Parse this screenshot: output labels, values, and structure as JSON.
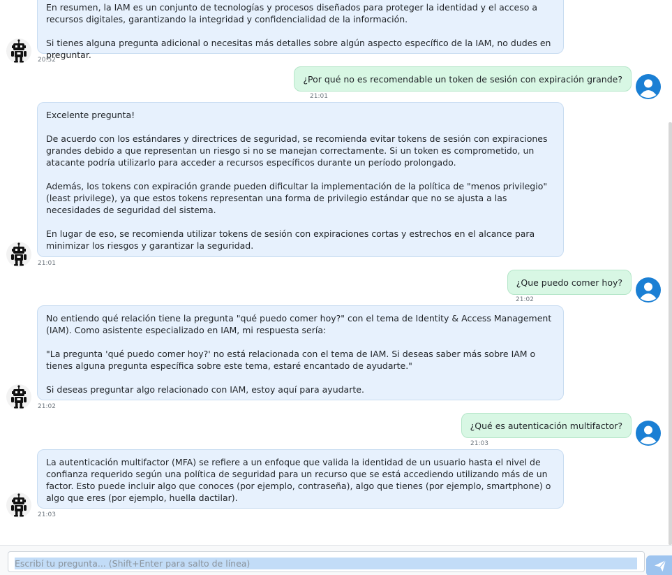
{
  "messages": [
    {
      "role": "assistant",
      "paragraphs": [
        "En resumen, la IAM es un conjunto de tecnologías y procesos diseñados para proteger la identidad y el acceso a recursos digitales, garantizando la integridad y confidencialidad de la información.",
        "Si tienes alguna pregunta adicional o necesitas más detalles sobre algún aspecto específico de la IAM, no dudes en preguntar."
      ],
      "time": "20:52"
    },
    {
      "role": "user",
      "text": "¿Por qué no es recomendable un token de sesión con expiración grande?",
      "time": "21:01"
    },
    {
      "role": "assistant",
      "paragraphs": [
        "Excelente pregunta!",
        "De acuerdo con los estándares y directrices de seguridad, se recomienda evitar tokens de sesión con expiraciones grandes debido a que representan un riesgo si no se manejan correctamente. Si un token es comprometido, un atacante podría utilizarlo para acceder a recursos específicos durante un período prolongado.",
        "Además, los tokens con expiración grande pueden dificultar la implementación de la política de \"menos privilegio\" (least privilege), ya que estos tokens representan una forma de privilegio estándar que no se ajusta a las necesidades de seguridad del sistema.",
        "En lugar de eso, se recomienda utilizar tokens de sesión con expiraciones cortas y estrechos en el alcance para minimizar los riesgos y garantizar la seguridad."
      ],
      "time": "21:01"
    },
    {
      "role": "user",
      "text": "¿Que puedo comer hoy?",
      "time": "21:02"
    },
    {
      "role": "assistant",
      "paragraphs": [
        "No entiendo qué relación tiene la pregunta \"qué puedo comer hoy?\" con el tema de Identity & Access Management (IAM). Como asistente especializado en IAM, mi respuesta sería:",
        "\"La pregunta 'qué puedo comer hoy?' no está relacionada con el tema de IAM. Si deseas saber más sobre IAM o tienes alguna pregunta específica sobre este tema, estaré encantado de ayudarte.\"",
        "Si deseas preguntar algo relacionado con IAM, estoy aquí para ayudarte."
      ],
      "time": "21:02"
    },
    {
      "role": "user",
      "text": "¿Qué es autenticación multifactor?",
      "time": "21:03"
    },
    {
      "role": "assistant",
      "paragraphs": [
        "La autenticación multifactor (MFA) se refiere a un enfoque que valida la identidad de un usuario hasta el nivel de confianza requerido según una política de seguridad para un recurso que se está accediendo utilizando más de un factor. Esto puede incluir algo que conoces (por ejemplo, contraseña), algo que tienes (por ejemplo, smartphone) o algo que eres (por ejemplo, huella dactilar)."
      ],
      "time": "21:03"
    }
  ],
  "composer": {
    "placeholder": "Escribí tu pregunta... (Shift+Enter para salto de línea)",
    "send_icon": "paper-plane-icon"
  },
  "icons": {
    "assistant_avatar": "robot-icon",
    "user_avatar": "user-circle-icon"
  },
  "colors": {
    "assistant_bubble": "#e7f1fd",
    "user_bubble": "#d8f7e4",
    "user_avatar": "#1a7fd4",
    "send_button": "#9ec4ef"
  }
}
